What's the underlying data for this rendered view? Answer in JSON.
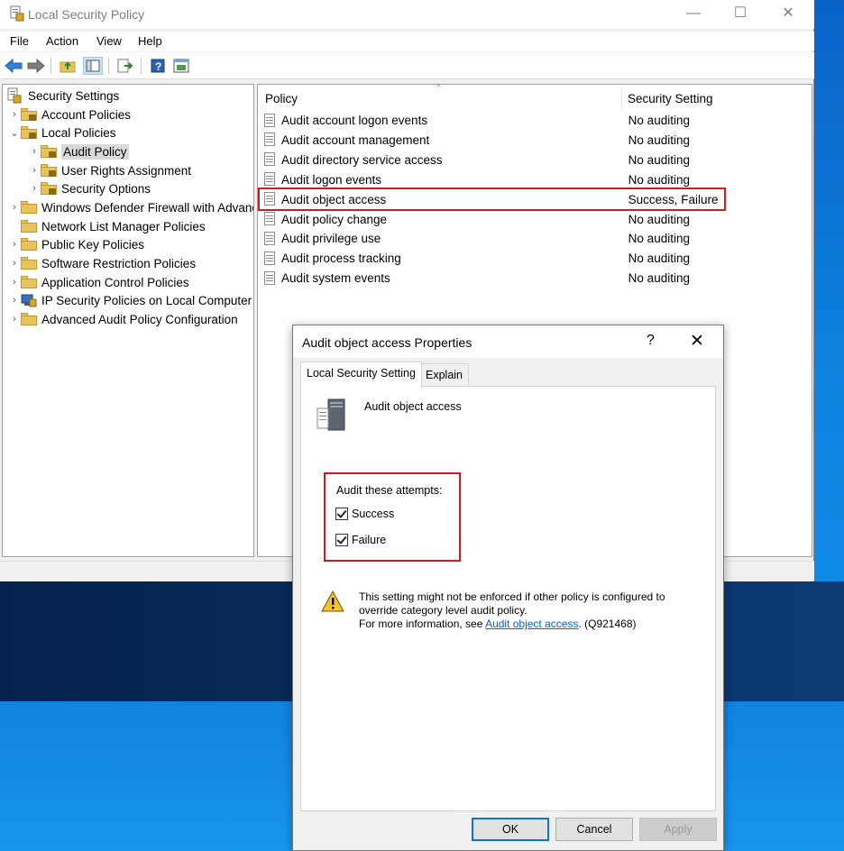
{
  "window": {
    "title": "Local Security Policy",
    "controls": [
      "—",
      "☐",
      "✕"
    ]
  },
  "menu": [
    "File",
    "Action",
    "View",
    "Help"
  ],
  "tree": [
    {
      "label": "Security Settings",
      "level": 0,
      "arrow": "",
      "icon": "settings-root-icon"
    },
    {
      "label": "Account Policies",
      "level": 1,
      "arrow": "›",
      "icon": "locked-folder-icon"
    },
    {
      "label": "Local Policies",
      "level": 1,
      "arrow": "⌄",
      "icon": "locked-folder-icon"
    },
    {
      "label": "Audit Policy",
      "level": 2,
      "arrow": "›",
      "icon": "locked-folder-icon",
      "selected": true
    },
    {
      "label": "User Rights Assignment",
      "level": 2,
      "arrow": "›",
      "icon": "locked-folder-icon"
    },
    {
      "label": "Security Options",
      "level": 2,
      "arrow": "›",
      "icon": "locked-folder-icon"
    },
    {
      "label": "Windows Defender Firewall with Advanced Security",
      "level": 1,
      "arrow": "›",
      "icon": "folder-icon"
    },
    {
      "label": "Network List Manager Policies",
      "level": 1,
      "arrow": "",
      "icon": "folder-icon"
    },
    {
      "label": "Public Key Policies",
      "level": 1,
      "arrow": "›",
      "icon": "folder-icon"
    },
    {
      "label": "Software Restriction Policies",
      "level": 1,
      "arrow": "›",
      "icon": "folder-icon"
    },
    {
      "label": "Application Control Policies",
      "level": 1,
      "arrow": "›",
      "icon": "folder-icon"
    },
    {
      "label": "IP Security Policies on Local Computer",
      "level": 1,
      "arrow": "›",
      "icon": "ip-security-icon"
    },
    {
      "label": "Advanced Audit Policy Configuration",
      "level": 1,
      "arrow": "›",
      "icon": "folder-icon"
    }
  ],
  "list": {
    "columns": [
      "Policy",
      "Security Setting"
    ],
    "rows": [
      {
        "policy": "Audit account logon events",
        "setting": "No auditing"
      },
      {
        "policy": "Audit account management",
        "setting": "No auditing"
      },
      {
        "policy": "Audit directory service access",
        "setting": "No auditing"
      },
      {
        "policy": "Audit logon events",
        "setting": "No auditing"
      },
      {
        "policy": "Audit object access",
        "setting": "Success, Failure",
        "highlighted": true
      },
      {
        "policy": "Audit policy change",
        "setting": "No auditing"
      },
      {
        "policy": "Audit privilege use",
        "setting": "No auditing"
      },
      {
        "policy": "Audit process tracking",
        "setting": "No auditing"
      },
      {
        "policy": "Audit system events",
        "setting": "No auditing"
      }
    ]
  },
  "dialog": {
    "title": "Audit object access Properties",
    "help": "?",
    "close": "✕",
    "tabs": [
      "Local Security Setting",
      "Explain"
    ],
    "policy_name": "Audit object access",
    "attempts_header": "Audit these attempts:",
    "success_label": "Success",
    "success_checked": true,
    "failure_label": "Failure",
    "failure_checked": true,
    "warning_line1": "This setting might not be enforced if other policy is configured to",
    "warning_line2": "override category level audit policy.",
    "warning_line3_prefix": "For more information, see ",
    "warning_link": "Audit object access",
    "warning_line3_suffix": ". (Q921468)",
    "ok": "OK",
    "cancel": "Cancel",
    "apply": "Apply"
  }
}
